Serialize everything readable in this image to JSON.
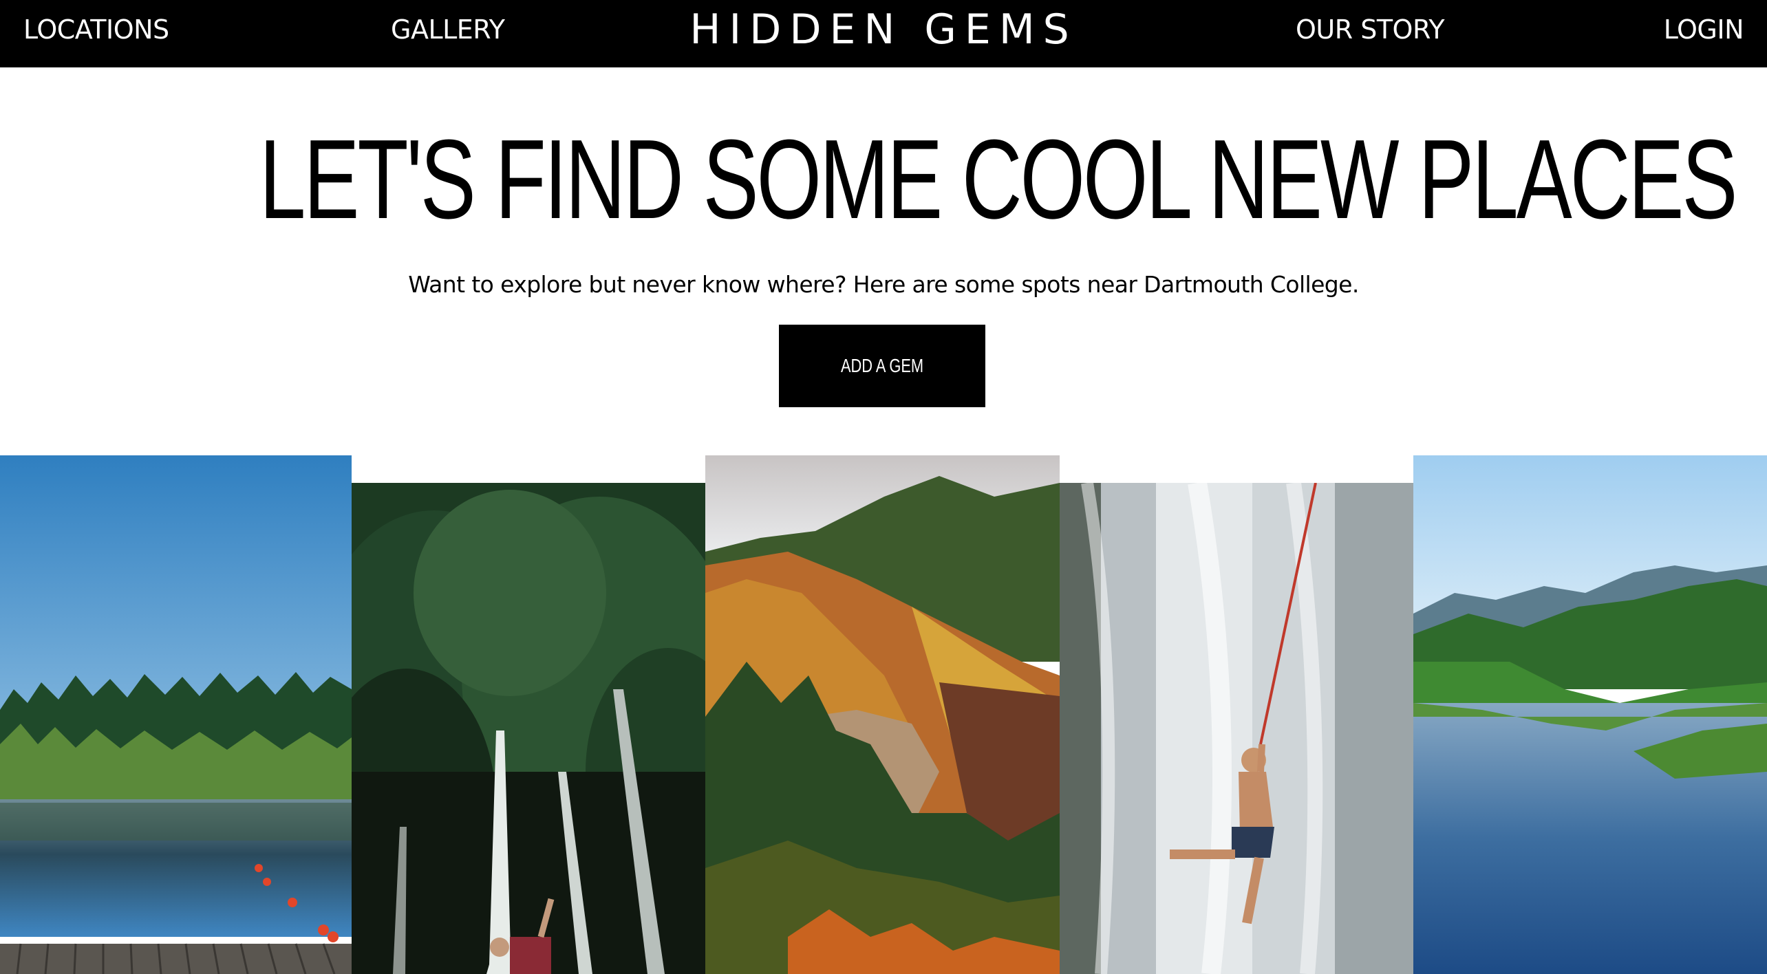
{
  "nav": {
    "brand": "HIDDEN GEMS",
    "links": [
      {
        "label": "LOCATIONS"
      },
      {
        "label": "GALLERY"
      },
      {
        "label": "OUR STORY"
      },
      {
        "label": "LOGIN"
      }
    ]
  },
  "hero": {
    "title": "LET'S FIND SOME COOL NEW PLACES",
    "subtitle": "Want to explore but never know where? Here are some spots near Dartmouth College.",
    "cta_label": "ADD A GEM"
  },
  "gallery": {
    "tiles": [
      {
        "subject": "lake-with-dock"
      },
      {
        "subject": "forest-climber"
      },
      {
        "subject": "autumn-mountain"
      },
      {
        "subject": "waterfall-rope-swing"
      },
      {
        "subject": "river-valley"
      }
    ]
  },
  "colors": {
    "navbar_bg": "#000000",
    "nav_text": "#ffffff",
    "page_bg": "#ffffff",
    "cta_bg": "#000000"
  }
}
